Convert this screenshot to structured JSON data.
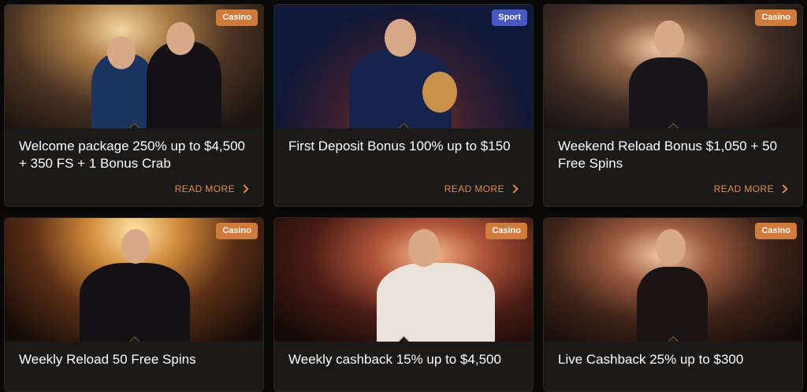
{
  "promotions": [
    {
      "category": "Casino",
      "title": "Welcome package 250% up to $4,500 + 350 FS + 1 Bonus Crab",
      "read_more": "READ MORE"
    },
    {
      "category": "Sport",
      "title": "First Deposit Bonus 100% up to $150",
      "read_more": "READ MORE"
    },
    {
      "category": "Casino",
      "title": "Weekend Reload Bonus $1,050 + 50 Free Spins",
      "read_more": "READ MORE"
    },
    {
      "category": "Casino",
      "title": "Weekly Reload 50 Free Spins"
    },
    {
      "category": "Casino",
      "title": "Weekly cashback 15% up to $4,500"
    },
    {
      "category": "Casino",
      "title": "Live Cashback 25% up to $300"
    }
  ],
  "colors": {
    "background": "#0b0a09",
    "card": "#1c1a19",
    "casino_tag": "#d07a3c",
    "sport_tag": "#4858c3",
    "accent": "#e08a45"
  }
}
